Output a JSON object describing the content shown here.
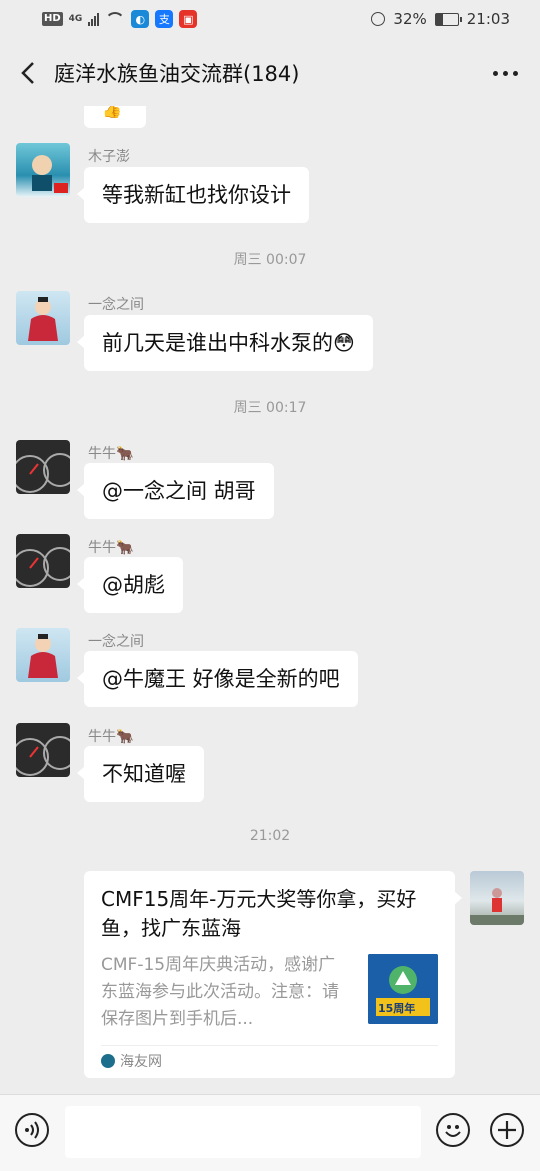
{
  "status_bar": {
    "left_badges": [
      "HD",
      "4G"
    ],
    "battery_percent_text": "32%",
    "battery_level": 0.32,
    "clock": "21:03"
  },
  "header": {
    "title": "庭洋水族鱼油交流群(184)",
    "back_icon": "chevron-left-icon",
    "more_icon": "more-dots-icon"
  },
  "messages": [
    {
      "sender": "木子澎",
      "text": "等我新缸也找你设计"
    },
    {
      "time": "周三 00:07"
    },
    {
      "sender": "一念之间",
      "text": "前几天是谁出中科水泵的😳"
    },
    {
      "time": "周三 00:17"
    },
    {
      "sender": "牛牛🐂",
      "text": "@一念之间  胡哥"
    },
    {
      "sender": "牛牛🐂",
      "text": "@胡彪"
    },
    {
      "sender": "一念之间",
      "text": "@牛魔王  好像是全新的吧"
    },
    {
      "sender": "牛牛🐂",
      "text": "不知道喔"
    },
    {
      "time": "21:02"
    }
  ],
  "link_card": {
    "title": "CMF15周年-万元大奖等你拿，买好鱼，找广东蓝海",
    "description": "CMF-15周年庆典活动，感谢广东蓝海参与此次活动。注意：请保存图片到手机后...",
    "thumb_text": "15周年",
    "source": "海友网"
  },
  "input_bar": {
    "voice_icon": "voice-icon",
    "emoji_icon": "emoji-icon",
    "plus_icon": "plus-icon"
  }
}
